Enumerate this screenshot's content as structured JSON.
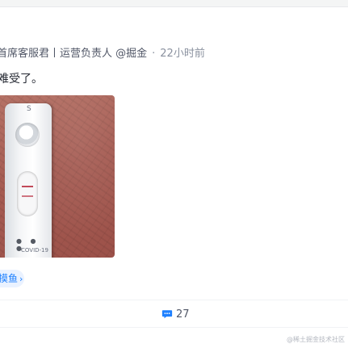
{
  "post": {
    "author_title": "首席客服君丨运营负责人 @掘金",
    "separator": "·",
    "time": "22小时前",
    "content": "难受了。",
    "image": {
      "cassette_letter_top": "S",
      "cassette_mark_bottom": "COVID-19"
    }
  },
  "topic_tag": {
    "label": "摸鱼",
    "icon": "chevron-right-icon"
  },
  "actions": {
    "comment_count": "27",
    "comment_icon": "comment-bubble-icon",
    "accent_color": "#1e80ff"
  },
  "watermark": "@稀土掘金技术社区"
}
